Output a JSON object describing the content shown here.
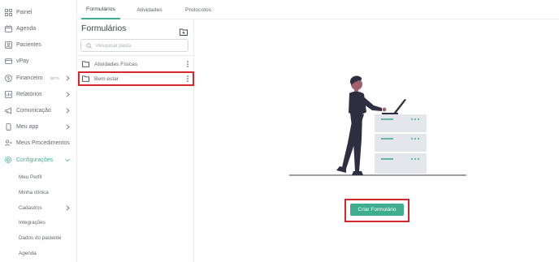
{
  "sidebar": {
    "items": [
      {
        "label": "Painel",
        "icon": "dashboard-icon"
      },
      {
        "label": "Agenda",
        "icon": "calendar-icon"
      },
      {
        "label": "Pacientes",
        "icon": "patients-icon"
      },
      {
        "label": "vPay",
        "icon": "card-icon"
      },
      {
        "label": "Financeiro",
        "icon": "dollar-icon",
        "badge": "BETA"
      },
      {
        "label": "Relatórios",
        "icon": "reports-icon"
      },
      {
        "label": "Comunicação",
        "icon": "megaphone-icon"
      },
      {
        "label": "Meu app",
        "icon": "phone-icon"
      },
      {
        "label": "Meus Procedimentos",
        "icon": "procedures-icon"
      },
      {
        "label": "Configurações",
        "icon": "gear-icon"
      }
    ],
    "sub_items": [
      {
        "label": "Meu Perfil"
      },
      {
        "label": "Minha clínica"
      },
      {
        "label": "Cadastros"
      },
      {
        "label": "Integrações"
      },
      {
        "label": "Dados do paciente"
      },
      {
        "label": "Agenda"
      }
    ]
  },
  "tabs": [
    {
      "label": "Formulários"
    },
    {
      "label": "Atividades"
    },
    {
      "label": "Protocolos"
    }
  ],
  "panel": {
    "title": "Formulários",
    "search_placeholder": "Pesquisar pasta",
    "search_value": "",
    "folders": [
      {
        "label": "Atividades Físicas"
      },
      {
        "label": "Bem estar"
      }
    ]
  },
  "main": {
    "create_button_label": "Criar Formulário"
  },
  "colors": {
    "accent": "#3fae8f",
    "highlight": "#d6262e",
    "illustration_dark": "#2f2e41",
    "illustration_light": "#e3e6ea"
  }
}
